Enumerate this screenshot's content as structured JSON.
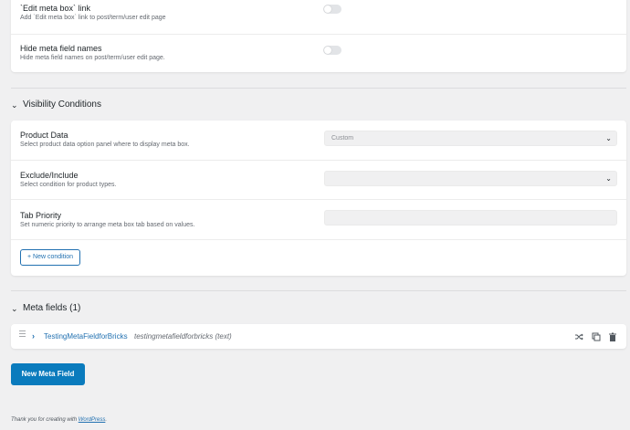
{
  "settings": {
    "edit_link_title": "`Edit meta box` link",
    "edit_link_desc": "Add `Edit meta box` link to post/term/user edit page",
    "hide_names_title": "Hide meta field names",
    "hide_names_desc": "Hide meta field names on post/term/user edit page."
  },
  "visibility": {
    "section_title": "Visibility Conditions",
    "product_data_title": "Product Data",
    "product_data_desc": "Select product data option panel where to display meta box.",
    "product_data_value": "Custom",
    "exclude_title": "Exclude/Include",
    "exclude_desc": "Select condition for product types.",
    "exclude_value": "",
    "tab_priority_title": "Tab Priority",
    "tab_priority_desc": "Set numeric priority to arrange meta box tab based on values.",
    "tab_priority_value": "",
    "new_condition_label": "+ New condition"
  },
  "meta_fields": {
    "section_title": "Meta fields (1)",
    "items": [
      {
        "label": "TestingMetaFieldforBricks",
        "id_type": "testingmetafieldforbricks (text)"
      }
    ],
    "new_field_label": "New Meta Field"
  },
  "footer": {
    "prefix": "Thank you for creating with ",
    "link": "WordPress",
    "suffix": "."
  },
  "colors": {
    "accent": "#2271b1",
    "primary_button": "#0a7bbd",
    "background": "#f0f0f1"
  }
}
